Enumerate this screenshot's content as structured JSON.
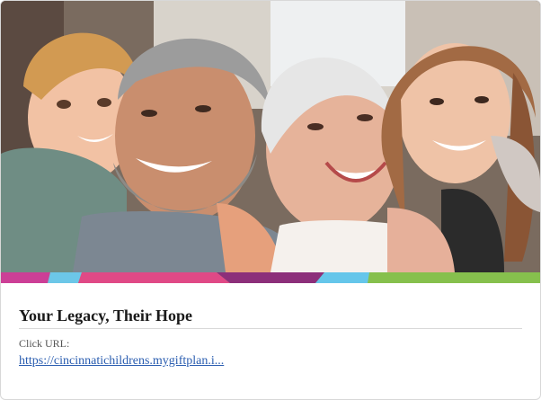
{
  "card": {
    "title": "Your Legacy, Their Hope",
    "url_label": "Click URL:",
    "url_text": "https://cincinnatichildrens.mygiftplan.i..."
  },
  "image": {
    "description_icon": "family-photo"
  },
  "stripe": {
    "colors": [
      "#cc3f96",
      "#6cc7e8",
      "#e04986",
      "#8c2f7a",
      "#65c6ea",
      "#86c04d"
    ]
  }
}
